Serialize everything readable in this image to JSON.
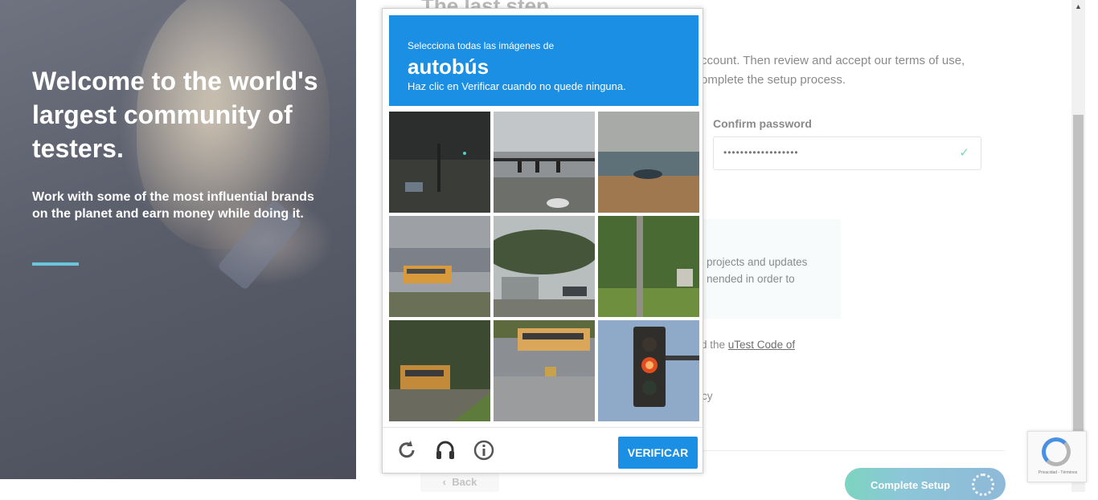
{
  "hero": {
    "title": "Welcome to the world's largest community of testers.",
    "subtitle": "Work with some of the most influential brands on the planet and earn money while doing it.",
    "accent_color": "#6cc4dd"
  },
  "form": {
    "step_heading": "The last step",
    "intro_text": "ccount. Then review and accept our terms of use, omplete the setup process.",
    "confirm_password_label": "Confirm password",
    "confirm_password_value": "••••••••••••••••••",
    "info_text": "projects and updates nended in order to",
    "code_prefix": "d the ",
    "code_link": "uTest Code of",
    "policy_fragment": "cy",
    "back_label": "Back",
    "complete_label": "Complete Setup"
  },
  "captcha": {
    "instruction": "Selecciona todas las imágenes de",
    "target": "autobús",
    "hint": "Haz clic en Verificar cuando no quede ninguna.",
    "verify_label": "VERIFICAR",
    "header_color": "#1a8fe3",
    "tiles": [
      {
        "scene": "dark-street"
      },
      {
        "scene": "intersection-signals"
      },
      {
        "scene": "field-car"
      },
      {
        "scene": "school-bus-lot"
      },
      {
        "scene": "bus-stop-trees"
      },
      {
        "scene": "tree-yard"
      },
      {
        "scene": "school-bus-trees"
      },
      {
        "scene": "bus-parking"
      },
      {
        "scene": "traffic-light-red"
      }
    ]
  },
  "recaptcha_badge": {
    "terms": "Privacidad - Términos"
  }
}
